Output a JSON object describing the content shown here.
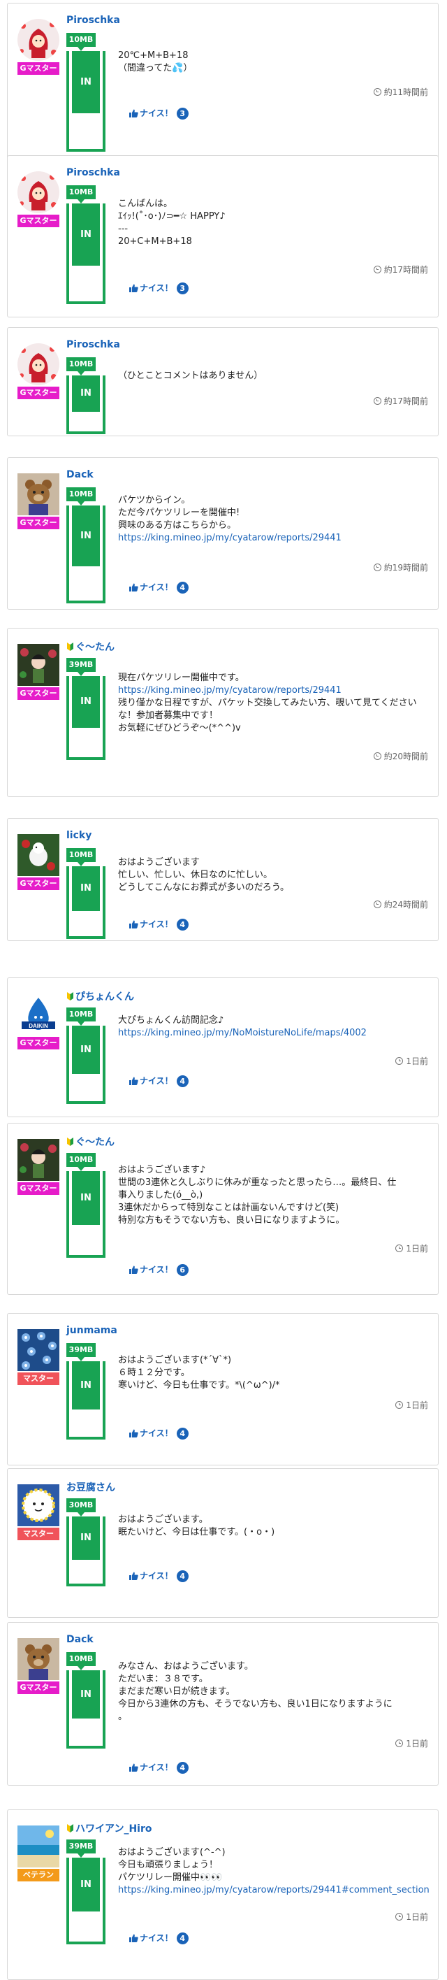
{
  "colors": {
    "accent": "#1a63b8",
    "in_green": "#18a353",
    "rank_g": "#e61cc9",
    "rank_m": "#f0535a",
    "rank_v": "#f39a1a"
  },
  "icons": {
    "time": "clock-icon",
    "nice": "thumbs-up-icon",
    "beginner": "beginner-leaf-icon"
  },
  "posts": [
    {
      "user": "Piroschka",
      "rank": "Gマスター",
      "mb": "10MB",
      "in": "IN",
      "lines": [
        "20℃+M+B+18",
        "（間違ってた💦）"
      ],
      "time": "約11時間前",
      "nice": "ナイス！",
      "count": "3"
    },
    {
      "user": "Piroschka",
      "rank": "Gマスター",
      "mb": "10MB",
      "in": "IN",
      "lines": [
        "こんばんは。",
        "ｴｲｯ!(˚･o･)ﾉ⊃━☆ HAPPY♪",
        "---",
        "20+C+M+B+18"
      ],
      "time": "約17時間前",
      "nice": "ナイス！",
      "count": "3"
    },
    {
      "user": "Piroschka",
      "rank": "Gマスター",
      "mb": "10MB",
      "in": "IN",
      "lines": [
        "（ひとことコメントはありません）"
      ],
      "time": "約17時間前"
    },
    {
      "user": "Dack",
      "rank": "Gマスター",
      "mb": "10MB",
      "in": "IN",
      "lines": [
        "パケツからイン。",
        "ただ今パケツリレーを開催中!",
        "興味のある方はこちらから。"
      ],
      "url": "https://king.mineo.jp/my/cyatarow/reports/29441",
      "time": "約19時間前",
      "nice": "ナイス！",
      "count": "4"
    },
    {
      "user": "ぐ〜たん",
      "rank": "Gマスター",
      "mb": "39MB",
      "in": "IN",
      "lines": [
        "現在パケツリレー開催中です。"
      ],
      "url": "https://king.mineo.jp/my/cyatarow/reports/29441",
      "after": [
        "残り僅かな日程ですが、パケット交換してみたい方、覗いて見てください",
        "な！参加者募集中です！",
        "お気軽にぜひどうぞ〜(*^^)v"
      ],
      "time": "約20時間前"
    },
    {
      "user": "licky",
      "rank": "Gマスター",
      "mb": "10MB",
      "in": "IN",
      "lines": [
        "おはようございます",
        "忙しい、忙しい、休日なのに忙しい。",
        "どうしてこんなにお葬式が多いのだろう。"
      ],
      "time": "約24時間前",
      "nice": "ナイス！",
      "count": "4"
    },
    {
      "user": "ぴちょんくん",
      "rank": "Gマスター",
      "mb": "10MB",
      "in": "IN",
      "lines": [
        "大ぴちょんくん訪問記念♪"
      ],
      "url": "https://king.mineo.jp/my/NoMoistureNoLife/maps/4002",
      "time": "1日前",
      "nice": "ナイス！",
      "count": "4"
    },
    {
      "user": "ぐ〜たん",
      "rank": "Gマスター",
      "mb": "10MB",
      "in": "IN",
      "lines": [
        "おはようございます♪",
        "世間の3連休と久しぶりに休みが重なったと思ったら…。最終日、仕",
        "事入りました(ó__ò,)",
        "3連休だからって特別なことは計画ないんですけど(笑)",
        "特別な方もそうでない方も、良い日になりますように。"
      ],
      "time": "1日前",
      "nice": "ナイス！",
      "count": "6"
    },
    {
      "user": "junmama",
      "rank": "マスター",
      "mb": "39MB",
      "in": "IN",
      "lines": [
        "おはようございます(*´∀`*)",
        "６時１２分です。",
        "寒いけど、今日も仕事です。*\\(^ω^)/*"
      ],
      "time": "1日前",
      "nice": "ナイス！",
      "count": "4"
    },
    {
      "user": "お豆腐さん",
      "rank": "マスター",
      "mb": "30MB",
      "in": "IN",
      "lines": [
        "おはようございます。",
        "眠たいけど、今日は仕事です。(・o・)"
      ],
      "time": "",
      "nice": "ナイス！",
      "count": "4"
    },
    {
      "user": "Dack",
      "rank": "Gマスター",
      "mb": "10MB",
      "in": "IN",
      "lines": [
        "みなさん、おはようございます。",
        "ただいま：３８です。",
        "まだまだ寒い日が続きます。",
        "今日から3連休の方も、そうでない方も、良い1日になりますように",
        "。"
      ],
      "time": "1日前",
      "nice": "ナイス！",
      "count": "4"
    },
    {
      "user": "ハワイアン_Hiro",
      "rank": "ベテラン",
      "mb": "39MB",
      "in": "IN",
      "lines": [
        "おはようございます(^-^)",
        "今日も頑張りましょう！",
        "パケツリレー開催中👀👀"
      ],
      "url": "https://king.mineo.jp/my/cyatarow/reports/29441#comment_section",
      "time": "1日前",
      "nice": "ナイス！",
      "count": "4"
    }
  ]
}
